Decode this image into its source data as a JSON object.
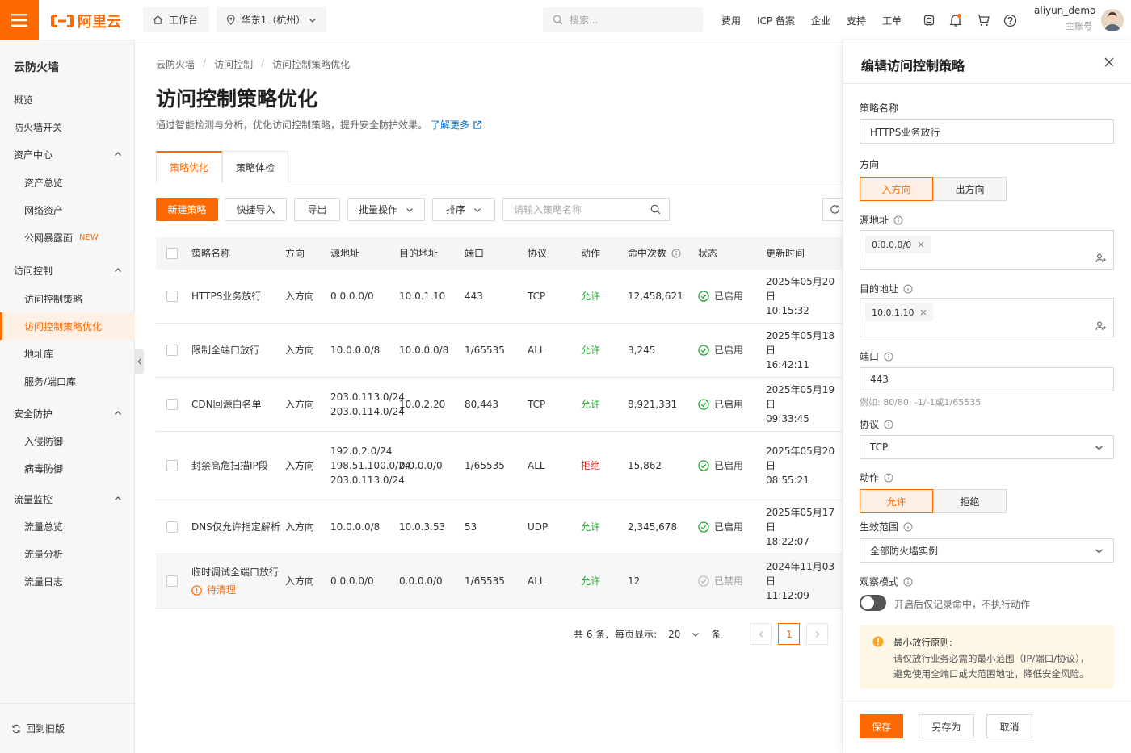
{
  "topbar": {
    "logo_text": "阿里云",
    "workbench": "工作台",
    "region": "华东1（杭州）",
    "search_placeholder": "搜索...",
    "links": [
      "费用",
      "ICP 备案",
      "企业",
      "支持",
      "工单"
    ],
    "username": "aliyun_demo",
    "account_role": "主账号"
  },
  "sidebar": {
    "title": "云防火墙",
    "items": [
      {
        "label": "概览"
      },
      {
        "label": "防火墙开关"
      },
      {
        "label": "资产中心"
      },
      {
        "label": "资产总览"
      },
      {
        "label": "网络资产"
      },
      {
        "label": "公网暴露面",
        "badge": "NEW"
      },
      {
        "label": "访问控制"
      },
      {
        "label": "访问控制策略"
      },
      {
        "label": "访问控制策略优化"
      },
      {
        "label": "地址库"
      },
      {
        "label": "服务/端口库"
      },
      {
        "label": "安全防护"
      },
      {
        "label": "入侵防御"
      },
      {
        "label": "病毒防御"
      },
      {
        "label": "流量监控"
      },
      {
        "label": "流量总览"
      },
      {
        "label": "流量分析"
      },
      {
        "label": "流量日志"
      }
    ],
    "footer": "回到旧版"
  },
  "main": {
    "breadcrumb": [
      "云防火墙",
      "访问控制",
      "访问控制策略优化"
    ],
    "title": "访问控制策略优化",
    "desc": "通过智能检测与分析，优化访问控制策略，提升安全防护效果。",
    "learn_more": "了解更多",
    "tabs": [
      "策略优化",
      "策略体检"
    ],
    "toolbar": {
      "new": "新建策略",
      "import": "快捷导入",
      "export": "导出",
      "batch": "批量操作",
      "sort": "排序",
      "search_placeholder": "请输入策略名称"
    },
    "columns": [
      "策略名称",
      "方向",
      "源地址",
      "目的地址",
      "端口",
      "协议",
      "动作",
      "命中次数",
      "状态",
      "更新时间"
    ],
    "rows": [
      {
        "name": "HTTPS业务放行",
        "dir": "入方向",
        "src": "0.0.0.0/0",
        "dst": "10.0.1.10",
        "port": "443",
        "proto": "TCP",
        "action": "允许",
        "hits": "12,458,621",
        "status": "已启用",
        "date": "2025年05月20日",
        "time": "10:15:32"
      },
      {
        "name": "限制全端口放行",
        "dir": "入方向",
        "src": "10.0.0.0/8",
        "dst": "10.0.0.0/8",
        "port": "1/65535",
        "proto": "ALL",
        "action": "允许",
        "hits": "3,245",
        "status": "已启用",
        "date": "2025年05月18日",
        "time": "16:42:11"
      },
      {
        "name": "CDN回源白名单",
        "dir": "入方向",
        "src": "203.0.113.0/24\n203.0.114.0/24",
        "dst": "10.0.2.20",
        "port": "80,443",
        "proto": "TCP",
        "action": "允许",
        "hits": "8,921,331",
        "status": "已启用",
        "date": "2025年05月19日",
        "time": "09:33:45"
      },
      {
        "name": "封禁高危扫描IP段",
        "dir": "入方向",
        "src": "192.0.2.0/24\n198.51.100.0/24\n203.0.113.0/24",
        "dst": "0.0.0.0/0",
        "port": "1/65535",
        "proto": "ALL",
        "action": "拒绝",
        "hits": "15,862",
        "status": "已启用",
        "date": "2025年05月20日",
        "time": "08:55:21"
      },
      {
        "name": "DNS仅允许指定解析",
        "dir": "入方向",
        "src": "10.0.0.0/8",
        "dst": "10.0.3.53",
        "port": "53",
        "proto": "UDP",
        "action": "允许",
        "hits": "2,345,678",
        "status": "已启用",
        "date": "2025年05月17日",
        "time": "18:22:07"
      },
      {
        "name": "临时调试全端口放行",
        "tag": "待清理",
        "dir": "入方向",
        "src": "0.0.0.0/0",
        "dst": "0.0.0.0/0",
        "port": "1/65535",
        "proto": "ALL",
        "action": "允许",
        "hits": "12",
        "status": "已禁用",
        "date": "2024年11月03日",
        "time": "11:12:09"
      }
    ],
    "pager": {
      "total": "共 6 条,",
      "per_page_label": "每页显示:",
      "per_page": "20",
      "unit": "条",
      "current": "1"
    }
  },
  "drawer": {
    "title": "编辑访问控制策略",
    "name_label": "策略名称",
    "name_value": "HTTPS业务放行",
    "dir_label": "方向",
    "dir_options": [
      "入方向",
      "出方向"
    ],
    "src_label": "源地址",
    "src_tag": "0.0.0.0/0",
    "dst_label": "目的地址",
    "dst_tag": "10.0.1.10",
    "port_label": "端口",
    "port_value": "443",
    "port_hint": "例如: 80/80, -1/-1或1/65535",
    "proto_label": "协议",
    "proto_value": "TCP",
    "action_label": "动作",
    "action_options": [
      "允许",
      "拒绝"
    ],
    "scope_label": "生效范围",
    "scope_value": "全部防火墙实例",
    "observe_label": "观察模式",
    "observe_text": "开启后仅记录命中，不执行动作",
    "note_title": "最小放行原则:",
    "note_line1": "请仅放行业务必需的最小范围（IP/端口/协议），",
    "note_line2": "避免使用全端口或大范围地址，降低安全风险。",
    "save": "保存",
    "save_as": "另存为",
    "cancel": "取消"
  },
  "colors": {
    "brand": "#ff6a00",
    "allow": "#1fa72f",
    "deny": "#e0302b",
    "link": "#0070cc"
  }
}
